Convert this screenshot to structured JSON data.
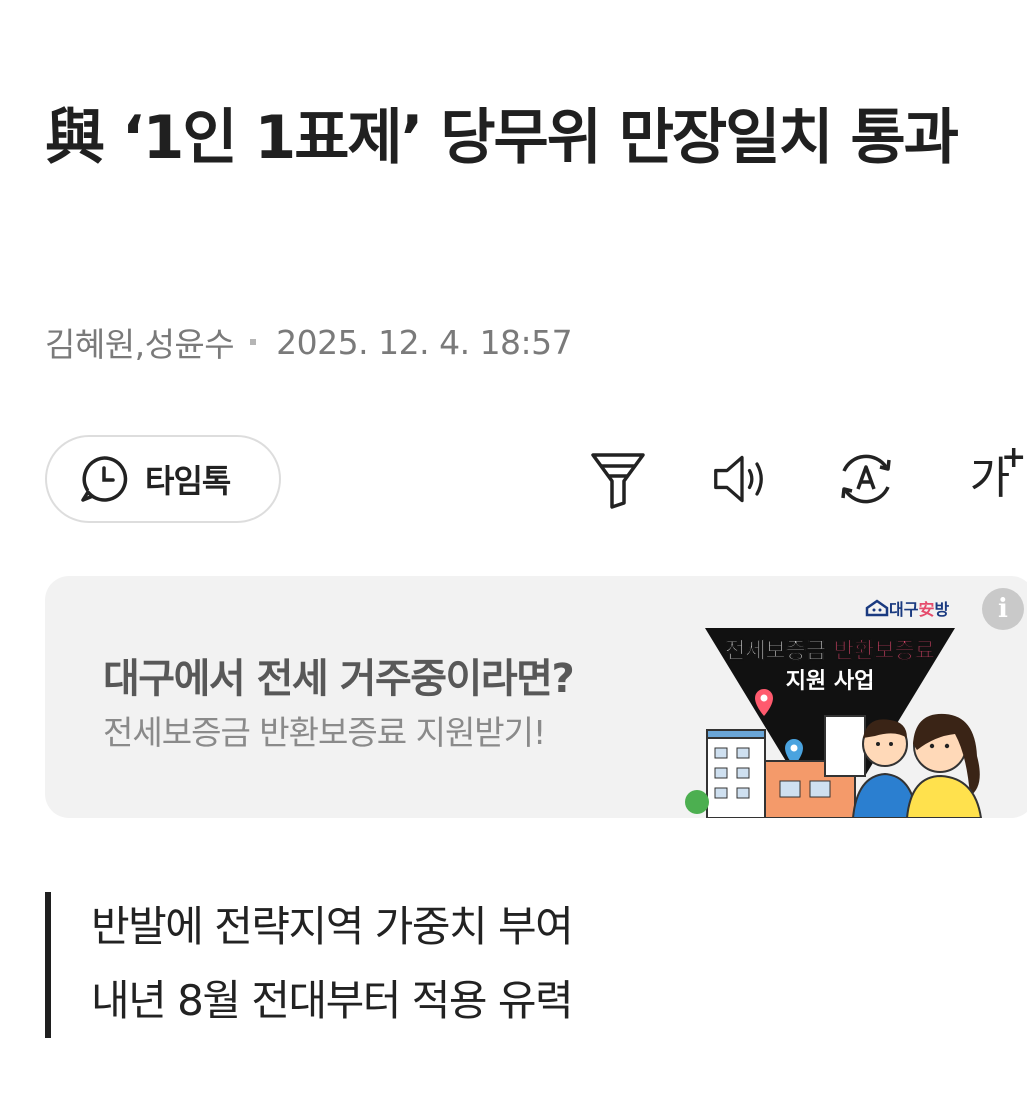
{
  "article": {
    "title": "與 ‘1인 1표제’ 당무위 만장일치 통과",
    "authors": "김혜원,성윤수",
    "datetime": "2025. 12. 4. 18:57"
  },
  "toolbar": {
    "timetalk_label": "타임톡",
    "summary_icon": "funnel-icon",
    "listen_icon": "speaker-icon",
    "translate_icon": "auto-translate-icon",
    "font_size_label": "가",
    "font_size_plus": "+"
  },
  "ad": {
    "headline": "대구에서 전세 거주중이라면?",
    "subtext": "전세보증금 반환보증료 지원받기!",
    "brand_prefix": "대구",
    "brand_accent": "安",
    "brand_suffix": "방",
    "banner_line1_a": "전세보증금 ",
    "banner_line1_b": "반환보증료",
    "banner_line2": "지원 사업",
    "info_label": "i"
  },
  "subheadings": [
    "반발에 전략지역 가중치 부여",
    "내년 8월 전대부터 적용 유력"
  ],
  "colors": {
    "accent_pink": "#e64b6c",
    "text_dark": "#202020",
    "meta_gray": "#7a7a7a",
    "ad_bg": "#f2f2f2"
  }
}
